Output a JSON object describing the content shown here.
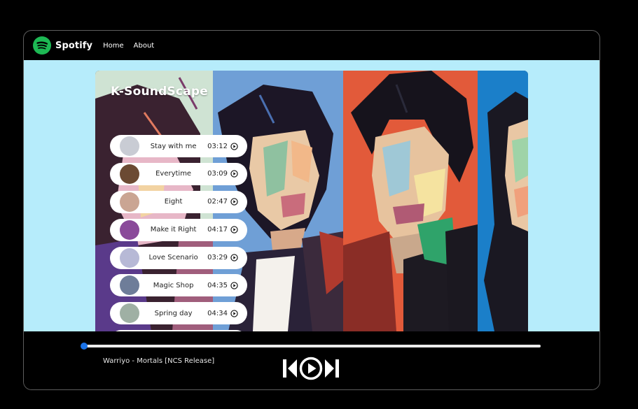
{
  "navbar": {
    "brand": "Spotify",
    "links": [
      "Home",
      "About"
    ]
  },
  "hero": {
    "title": "K-SoundScape"
  },
  "songs": [
    {
      "title": "Stay with me",
      "duration": "03:12",
      "thumb_color": "#c9ccd4"
    },
    {
      "title": "Everytime",
      "duration": "03:09",
      "thumb_color": "#6b4a33"
    },
    {
      "title": "Eight",
      "duration": "02:47",
      "thumb_color": "#caa593"
    },
    {
      "title": "Make it Right",
      "duration": "04:17",
      "thumb_color": "#8a4a9a"
    },
    {
      "title": "Love Scenario",
      "duration": "03:29",
      "thumb_color": "#b7b9d6"
    },
    {
      "title": "Magic Shop",
      "duration": "04:35",
      "thumb_color": "#6e7d99"
    },
    {
      "title": "Spring day",
      "duration": "04:34",
      "thumb_color": "#9fb0a4"
    }
  ],
  "player": {
    "now_playing": "Warriyo - Mortals [NCS Release]",
    "progress": 0.0
  },
  "colors": {
    "spotify_green": "#1db954",
    "content_bg": "#b6ecfb",
    "progress_accent": "#1a73e8"
  },
  "icons": {
    "logo": "spotify-logo-icon",
    "song_play": "play-circle-icon",
    "prev": "skip-previous-icon",
    "play": "play-circle-icon",
    "next": "skip-next-icon"
  }
}
